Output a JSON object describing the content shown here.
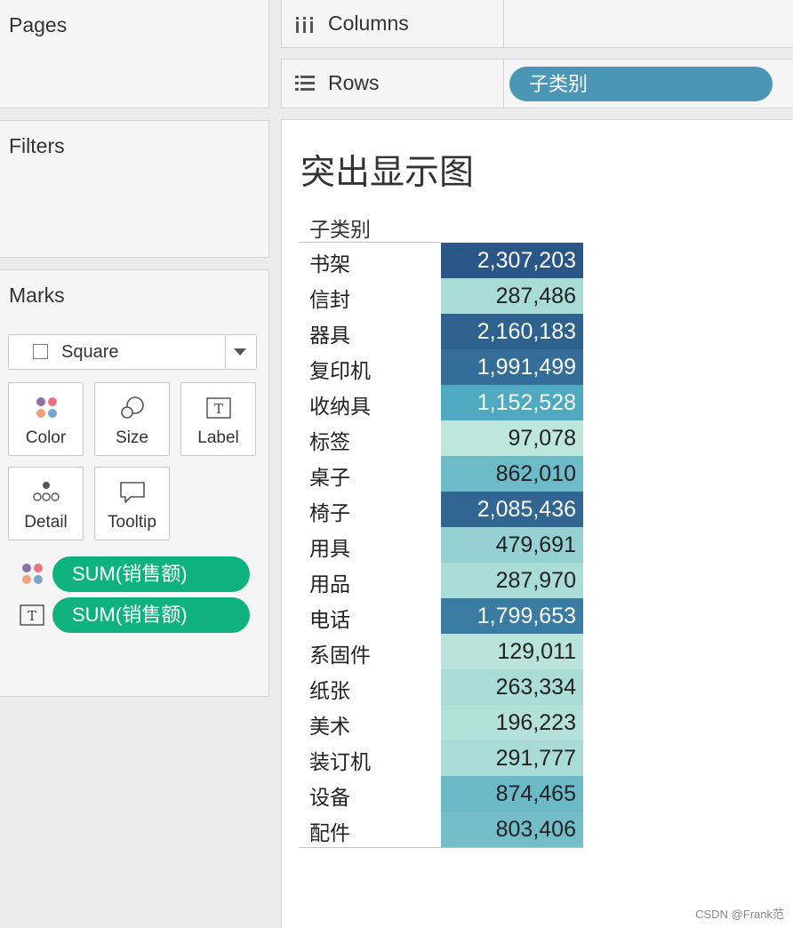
{
  "pages": {
    "title": "Pages"
  },
  "filters": {
    "title": "Filters"
  },
  "marks": {
    "title": "Marks",
    "mark_type": "Square",
    "buttons": {
      "color": "Color",
      "size": "Size",
      "label": "Label",
      "detail": "Detail",
      "tooltip": "Tooltip"
    },
    "fields": [
      {
        "encoding": "color-icon",
        "label": "SUM(销售额)"
      },
      {
        "encoding": "text-icon",
        "label": "SUM(销售额)"
      }
    ]
  },
  "columns_shelf": {
    "label": "Columns"
  },
  "rows_shelf": {
    "label": "Rows",
    "pill": "子类别"
  },
  "view": {
    "title": "突出显示图",
    "column_header": "子类别",
    "color_scale": {
      "low": "#bde6dc",
      "mid": "#4aa6bf",
      "high": "#2b5688"
    },
    "rows": [
      {
        "category": "书架",
        "display": "2,307,203",
        "value": 2307203
      },
      {
        "category": "信封",
        "display": "287,486",
        "value": 287486
      },
      {
        "category": "器具",
        "display": "2,160,183",
        "value": 2160183
      },
      {
        "category": "复印机",
        "display": "1,991,499",
        "value": 1991499
      },
      {
        "category": "收纳具",
        "display": "1,152,528",
        "value": 1152528
      },
      {
        "category": "标签",
        "display": "97,078",
        "value": 97078
      },
      {
        "category": "桌子",
        "display": "862,010",
        "value": 862010
      },
      {
        "category": "椅子",
        "display": "2,085,436",
        "value": 2085436
      },
      {
        "category": "用具",
        "display": "479,691",
        "value": 479691
      },
      {
        "category": "用品",
        "display": "287,970",
        "value": 287970
      },
      {
        "category": "电话",
        "display": "1,799,653",
        "value": 1799653
      },
      {
        "category": "系固件",
        "display": "129,011",
        "value": 129011
      },
      {
        "category": "纸张",
        "display": "263,334",
        "value": 263334
      },
      {
        "category": "美术",
        "display": "196,223",
        "value": 196223
      },
      {
        "category": "装订机",
        "display": "291,777",
        "value": 291777
      },
      {
        "category": "设备",
        "display": "874,465",
        "value": 874465
      },
      {
        "category": "配件",
        "display": "803,406",
        "value": 803406
      }
    ]
  },
  "watermark": "CSDN @Frank范"
}
